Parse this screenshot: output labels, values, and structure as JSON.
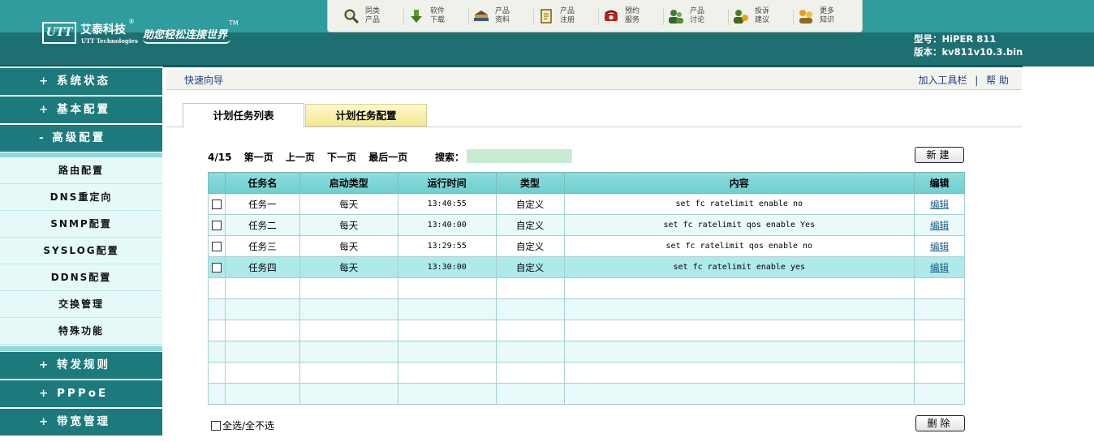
{
  "brand": {
    "logo_mark": "UTT",
    "name_cn": "艾泰科技",
    "name_en": "UTT Technologies",
    "registered": "®",
    "slogan": "助您轻松连接世界",
    "trademark": "TM"
  },
  "top_nav": [
    {
      "label1": "同类",
      "label2": "产品",
      "icon": "search-icon"
    },
    {
      "label1": "软件",
      "label2": "下载",
      "icon": "download-icon"
    },
    {
      "label1": "产品",
      "label2": "资料",
      "icon": "books-icon"
    },
    {
      "label1": "产品",
      "label2": "注册",
      "icon": "register-icon"
    },
    {
      "label1": "预约",
      "label2": "服务",
      "icon": "phone-icon"
    },
    {
      "label1": "产品",
      "label2": "讨论",
      "icon": "users-icon"
    },
    {
      "label1": "投诉",
      "label2": "建议",
      "icon": "feedback-icon"
    },
    {
      "label1": "更多",
      "label2": "知识",
      "icon": "knowledge-icon"
    }
  ],
  "device": {
    "model": "型号：HiPER 811",
    "version": "版本：kv811v10.3.bin"
  },
  "sidebar": {
    "sections": [
      {
        "label": "+ 系统状态"
      },
      {
        "label": "+ 基本配置"
      },
      {
        "label": "- 高级配置"
      },
      {
        "label": "+ 转发规则"
      },
      {
        "label": "+ PPPoE"
      },
      {
        "label": "+ 带宽管理"
      }
    ],
    "sub_items": [
      {
        "label": "路由配置"
      },
      {
        "label": "DNS重定向"
      },
      {
        "label": "SNMP配置"
      },
      {
        "label": "SYSLOG配置"
      },
      {
        "label": "DDNS配置"
      },
      {
        "label": "交换管理"
      },
      {
        "label": "特殊功能"
      }
    ]
  },
  "crumbbar": {
    "left": "快速向导",
    "add_toolbar": "加入工具栏",
    "separator": "|",
    "help": "帮 助"
  },
  "tabs": {
    "list": "计划任务列表",
    "config": "计划任务配置"
  },
  "pager": {
    "page_info": "4/15",
    "first": "第一页",
    "prev": "上一页",
    "next": "下一页",
    "last": "最后一页",
    "search_label": "搜索："
  },
  "buttons": {
    "new": "新建",
    "delete": "删除"
  },
  "table": {
    "headers": [
      "任务名",
      "启动类型",
      "运行时间",
      "类型",
      "内容",
      "编辑"
    ],
    "rows": [
      {
        "name": "任务一",
        "start_type": "每天",
        "time": "13:40:55",
        "type": "自定义",
        "content": "set fc ratelimit enable no",
        "edit": "编辑"
      },
      {
        "name": "任务二",
        "start_type": "每天",
        "time": "13:40:00",
        "type": "自定义",
        "content": "set fc ratelimit qos enable Yes",
        "edit": "编辑"
      },
      {
        "name": "任务三",
        "start_type": "每天",
        "time": "13:29:55",
        "type": "自定义",
        "content": "set fc ratelimit qos enable no",
        "edit": "编辑"
      },
      {
        "name": "任务四",
        "start_type": "每天",
        "time": "13:30:00",
        "type": "自定义",
        "content": "set fc ratelimit enable yes",
        "edit": "编辑"
      }
    ]
  },
  "select_all": "全选/全不选",
  "colors": {
    "header_teal": "#1d6f72",
    "sidebar_teal": "#1d7a7c",
    "table_header": "#8fdcdc",
    "selected_row": "#aeeaea",
    "link": "#1a5e8a"
  }
}
